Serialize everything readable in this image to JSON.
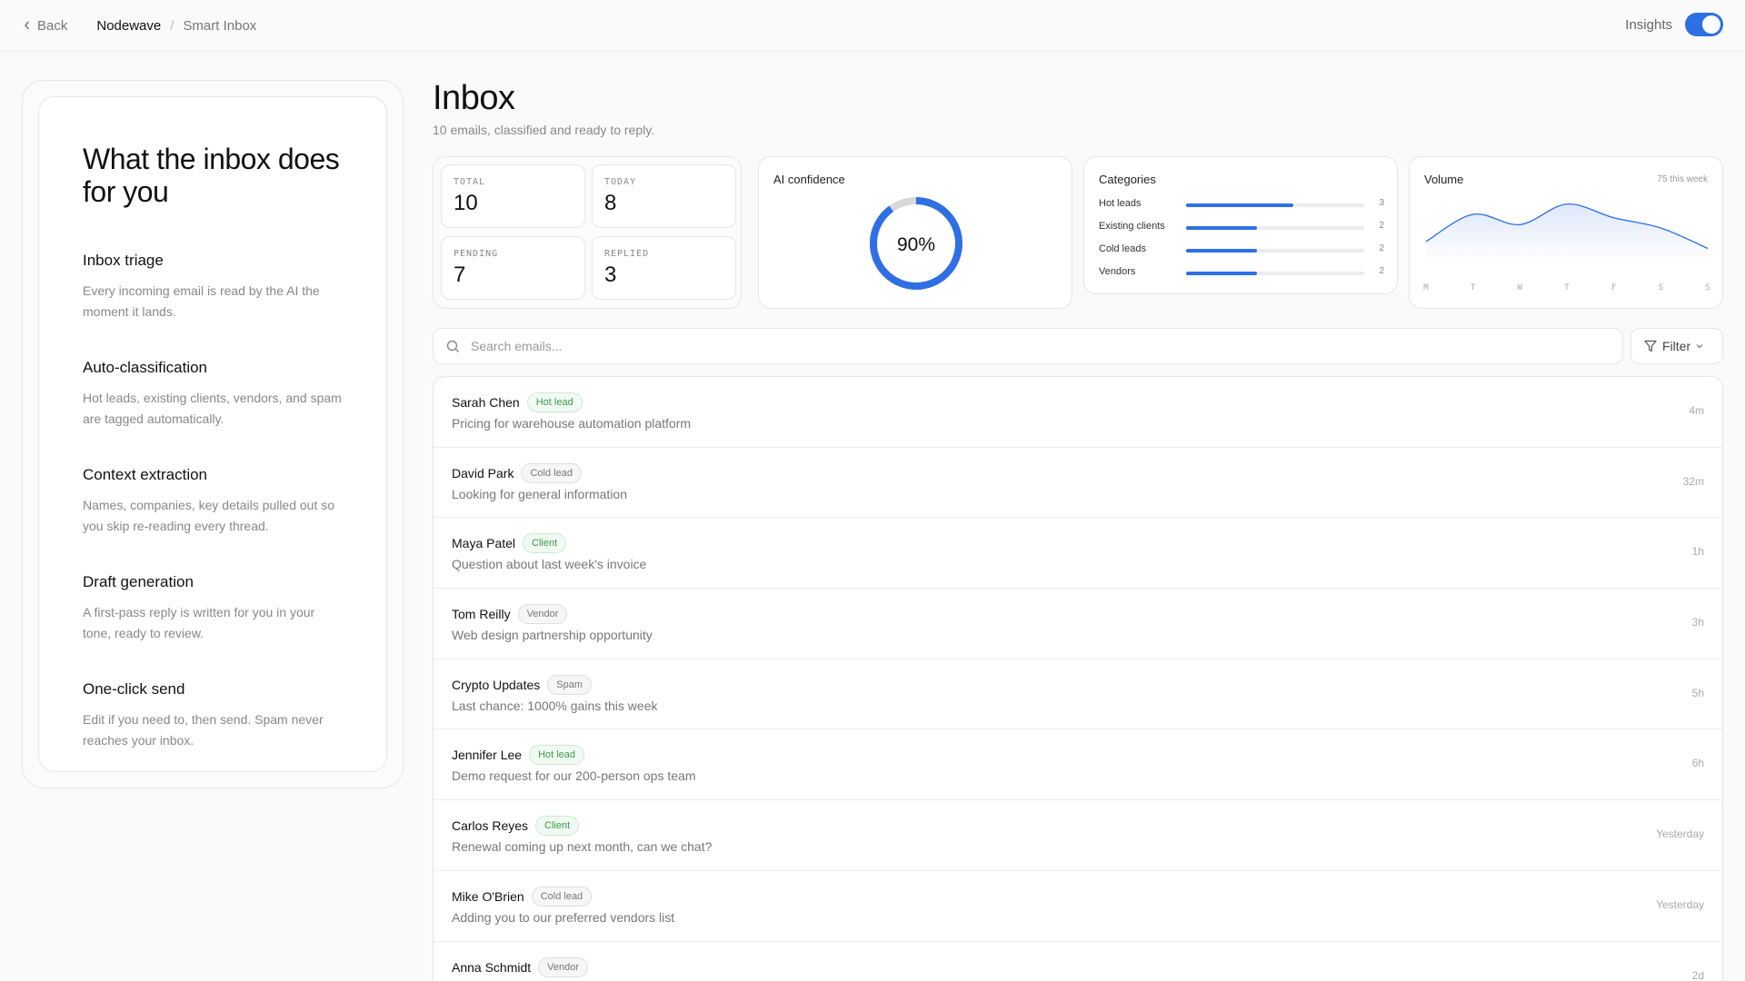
{
  "topbar": {
    "back_label": "Back",
    "breadcrumb_main": "Nodewave",
    "breadcrumb_sep": "/",
    "breadcrumb_sub": "Smart Inbox",
    "insights_label": "Insights",
    "insights_on": true,
    "accent": "#2f6fe4"
  },
  "left": {
    "title": "What the inbox does for you",
    "features": [
      {
        "title": "Inbox triage",
        "desc": "Every incoming email is read by the AI the moment it lands."
      },
      {
        "title": "Auto-classification",
        "desc": "Hot leads, existing clients, vendors, and spam are tagged automatically."
      },
      {
        "title": "Context extraction",
        "desc": "Names, companies, key details pulled out so you skip re-reading every thread."
      },
      {
        "title": "Draft generation",
        "desc": "A first-pass reply is written for you in your tone, ready to review."
      },
      {
        "title": "One-click send",
        "desc": "Edit if you need to, then send. Spam never reaches your inbox."
      }
    ]
  },
  "inbox": {
    "title": "Inbox",
    "subtitle": "10 emails, classified and ready to reply."
  },
  "stats": [
    {
      "label": "TOTAL",
      "value": "10"
    },
    {
      "label": "TODAY",
      "value": "8"
    },
    {
      "label": "PENDING",
      "value": "7"
    },
    {
      "label": "REPLIED",
      "value": "3"
    }
  ],
  "confidence": {
    "title": "AI confidence",
    "value_label": "90%",
    "fraction": 0.9
  },
  "categories": {
    "title": "Categories",
    "max": 5,
    "items": [
      {
        "name": "Hot leads",
        "count": 3
      },
      {
        "name": "Existing clients",
        "count": 2
      },
      {
        "name": "Cold leads",
        "count": 2
      },
      {
        "name": "Vendors",
        "count": 2
      }
    ]
  },
  "volume": {
    "title": "Volume",
    "note": "75 this week"
  },
  "chart_data": {
    "type": "area",
    "title": "Volume",
    "x": [
      "M",
      "T",
      "W",
      "T",
      "F",
      "S",
      "S"
    ],
    "values": [
      4,
      12,
      9,
      15,
      11,
      8,
      2
    ],
    "ylim": [
      0,
      16
    ],
    "grid": false
  },
  "search": {
    "placeholder": "Search emails..."
  },
  "filter": {
    "label": "Filter"
  },
  "emails": [
    {
      "name": "Sarah Chen",
      "tag": "Hot lead",
      "tone": "green",
      "subject": "Pricing for warehouse automation platform",
      "time": "4m"
    },
    {
      "name": "David Park",
      "tag": "Cold lead",
      "tone": "gray",
      "subject": "Looking for general information",
      "time": "32m"
    },
    {
      "name": "Maya Patel",
      "tag": "Client",
      "tone": "green",
      "subject": "Question about last week's invoice",
      "time": "1h"
    },
    {
      "name": "Tom Reilly",
      "tag": "Vendor",
      "tone": "gray",
      "subject": "Web design partnership opportunity",
      "time": "3h"
    },
    {
      "name": "Crypto Updates",
      "tag": "Spam",
      "tone": "gray",
      "subject": "Last chance: 1000% gains this week",
      "time": "5h"
    },
    {
      "name": "Jennifer Lee",
      "tag": "Hot lead",
      "tone": "green",
      "subject": "Demo request for our 200-person ops team",
      "time": "6h"
    },
    {
      "name": "Carlos Reyes",
      "tag": "Client",
      "tone": "green",
      "subject": "Renewal coming up next month, can we chat?",
      "time": "Yesterday"
    },
    {
      "name": "Mike O'Brien",
      "tag": "Cold lead",
      "tone": "gray",
      "subject": "Adding you to our preferred vendors list",
      "time": "Yesterday"
    },
    {
      "name": "Anna Schmidt",
      "tag": "Vendor",
      "tone": "gray",
      "subject": "",
      "time": "2d"
    }
  ]
}
